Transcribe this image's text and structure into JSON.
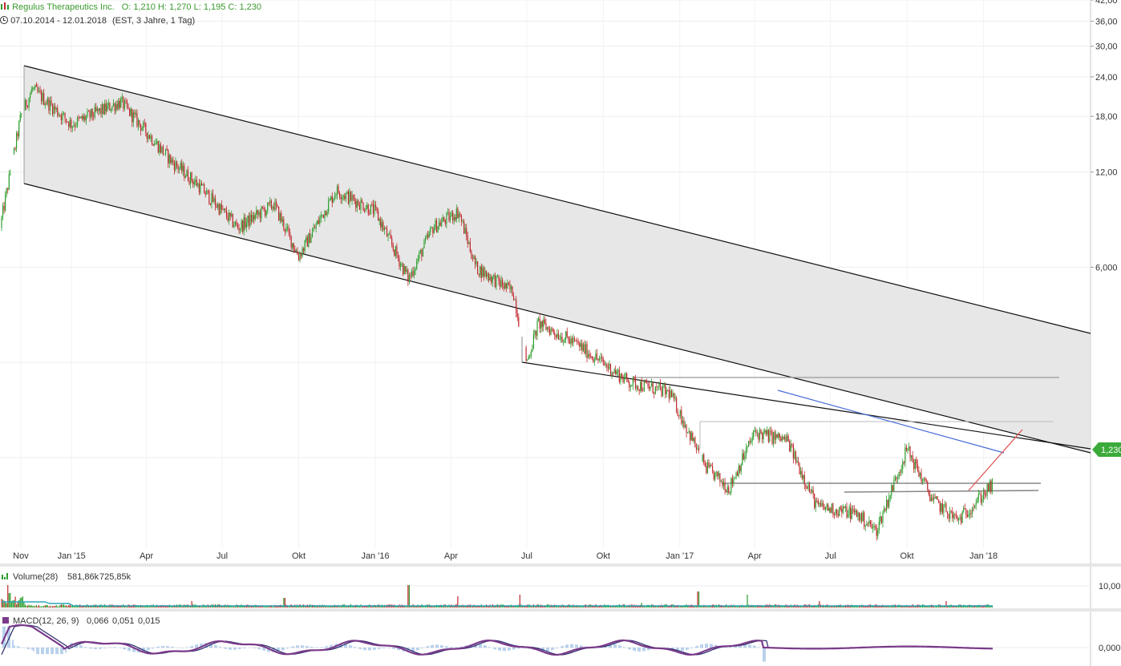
{
  "header": {
    "instrument": "Regulus Therapeutics Inc.",
    "ohlc_text": "O: 1,210  H: 1,270  L: 1,195  C: 1,230",
    "range_text": "07.10.2014 - 12.01.2018",
    "timezone_text": "(EST, 3 Jahre, 1 Tag)",
    "icon": "clock-icon",
    "chart_icon": "candlestick-icon"
  },
  "colors": {
    "up": "#2e9e2e",
    "down": "#c0282d",
    "channel_fill": "#e4e4e4",
    "trend_black": "#111111",
    "trend_blue": "#4a6ed8",
    "trend_red": "#e05050",
    "level_gray": "#999999",
    "last_price_bg": "#3aaa3a",
    "volume_avg": "#2fa5b8",
    "macd_line": "#7a3a8a",
    "signal_line": "#2a2a6a",
    "histogram": "#8ab4e0"
  },
  "chart_data": [
    {
      "type": "candlestick",
      "title": "Regulus Therapeutics Inc.",
      "y_scale": "log",
      "y_ticks": [
        "42,00",
        "36,00",
        "30,00",
        "24,00",
        "18,00",
        "12,00",
        "6,000"
      ],
      "x_ticks": [
        "Nov",
        "Jan '15",
        "Apr",
        "Jul",
        "Okt",
        "Jan '16",
        "Apr",
        "Jul",
        "Okt",
        "Jan '17",
        "Apr",
        "Jul",
        "Okt",
        "Jan '18"
      ],
      "last_price": "1,230",
      "approx_close_path": [
        {
          "date": "2014-10-07",
          "close": 8.0
        },
        {
          "date": "2014-11-01",
          "close": 18.0
        },
        {
          "date": "2014-11-15",
          "close": 22.0
        },
        {
          "date": "2015-01-01",
          "close": 17.0
        },
        {
          "date": "2015-03-01",
          "close": 20.0
        },
        {
          "date": "2015-05-01",
          "close": 13.0
        },
        {
          "date": "2015-06-01",
          "close": 11.0
        },
        {
          "date": "2015-07-20",
          "close": 8.0
        },
        {
          "date": "2015-09-01",
          "close": 9.5
        },
        {
          "date": "2015-10-01",
          "close": 6.5
        },
        {
          "date": "2015-11-15",
          "close": 10.5
        },
        {
          "date": "2016-01-01",
          "close": 9.0
        },
        {
          "date": "2016-02-10",
          "close": 5.5
        },
        {
          "date": "2016-03-10",
          "close": 8.0
        },
        {
          "date": "2016-04-10",
          "close": 9.0
        },
        {
          "date": "2016-05-01",
          "close": 6.0
        },
        {
          "date": "2016-06-15",
          "close": 5.0
        },
        {
          "date": "2016-07-01",
          "close": 3.0
        },
        {
          "date": "2016-07-15",
          "close": 4.0
        },
        {
          "date": "2016-09-01",
          "close": 3.4
        },
        {
          "date": "2016-11-01",
          "close": 2.6
        },
        {
          "date": "2016-12-20",
          "close": 2.4
        },
        {
          "date": "2017-02-01",
          "close": 1.4
        },
        {
          "date": "2017-03-01",
          "close": 1.2
        },
        {
          "date": "2017-04-01",
          "close": 1.8
        },
        {
          "date": "2017-05-10",
          "close": 1.7
        },
        {
          "date": "2017-06-15",
          "close": 1.05
        },
        {
          "date": "2017-08-01",
          "close": 1.0
        },
        {
          "date": "2017-08-25",
          "close": 0.88
        },
        {
          "date": "2017-10-01",
          "close": 1.6
        },
        {
          "date": "2017-11-01",
          "close": 1.1
        },
        {
          "date": "2017-12-01",
          "close": 0.95
        },
        {
          "date": "2018-01-12",
          "close": 1.23
        }
      ]
    },
    {
      "type": "bar",
      "title": "Volume(28)",
      "values_text": [
        "581,86k",
        "725,85k"
      ],
      "y_ticks": [
        "10,00"
      ]
    },
    {
      "type": "line",
      "title": "MACD(12, 26, 9)",
      "values_text": [
        "0,066",
        "0,051",
        "0,015"
      ],
      "y_ticks": [
        "0,000"
      ]
    }
  ]
}
